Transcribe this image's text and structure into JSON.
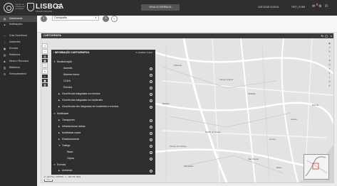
{
  "header": {
    "logo_text": "CENTRO DE OPERAÇÕES INTEGRADO",
    "city": "LISBOA",
    "city_sub": "CÂMARA MUNICIPAL",
    "new_occurrence": "NOVA OCORRÊNCIA",
    "datetime": "12/07/2018 13:45:16",
    "user": "TEST_COI05",
    "notif_count": "1"
  },
  "sidebar": {
    "items": [
      {
        "label": "Dashboards",
        "icon": "dashboard-icon"
      },
      {
        "label": "Notificações",
        "icon": "bell-icon"
      },
      {
        "label": "Criar Ocorrência",
        "icon": "plus-icon"
      },
      {
        "label": "Incidentes",
        "icon": "warning-icon"
      },
      {
        "label": "Eventos",
        "icon": "calendar-icon"
      },
      {
        "label": "Relatórios",
        "icon": "report-icon"
      },
      {
        "label": "Meios e Recursos",
        "icon": "truck-icon"
      },
      {
        "label": "Biblioteca",
        "icon": "book-icon"
      },
      {
        "label": "Entrepatamento",
        "icon": "gear-icon"
      }
    ]
  },
  "toolbar": {
    "select_value": "Cartografia"
  },
  "panel": {
    "title": "CARTOGRAFIA"
  },
  "layers": {
    "title": "INFORMAÇÃO CARTOGRÁFICA",
    "clean": "LIMPAR TUDO",
    "items": [
      {
        "label": "Monitorização",
        "level": 0
      },
      {
        "label": "Alarmes",
        "level": 1
      },
      {
        "label": "Alarmes inteco",
        "level": 1
      },
      {
        "label": "CCM's",
        "level": 1
      },
      {
        "label": "Eventos",
        "level": 1
      },
      {
        "label": "Ocorrências integradas em eventos",
        "level": 1
      },
      {
        "label": "Ocorrências integradas em Incidentes",
        "level": 1
      },
      {
        "label": "Ocorrências não integradas em incidentes e eventos",
        "level": 1
      },
      {
        "label": "Mobilidade",
        "level": 0
      },
      {
        "label": "Transportes",
        "level": 1
      },
      {
        "label": "Infraestruturas viárias",
        "level": 1
      },
      {
        "label": "Mobilidade suave",
        "level": 1
      },
      {
        "label": "Estacionamento",
        "level": 1
      },
      {
        "label": "Tráfego",
        "level": 1
      },
      {
        "label": "Waze",
        "level": 2
      },
      {
        "label": "Cepsa",
        "level": 2
      },
      {
        "label": "Eventos",
        "level": 0
      },
      {
        "label": "Ambiente",
        "level": 1
      }
    ]
  },
  "map": {
    "coords": "X: -94775.4, 1007559 ; Y: -106 759, 8001",
    "scale": "500 m",
    "labels": [
      {
        "text": "Telheiras"
      },
      {
        "text": "Alvalade"
      },
      {
        "text": "Areeiro"
      },
      {
        "text": "Penha de França"
      },
      {
        "text": "Campo de Ourique"
      },
      {
        "text": "Arroios"
      },
      {
        "text": "São Vicente"
      },
      {
        "text": "Marvila"
      },
      {
        "text": "Campolide"
      },
      {
        "text": "Benfica"
      },
      {
        "text": "Campo Grande"
      },
      {
        "text": "Belém"
      }
    ]
  }
}
